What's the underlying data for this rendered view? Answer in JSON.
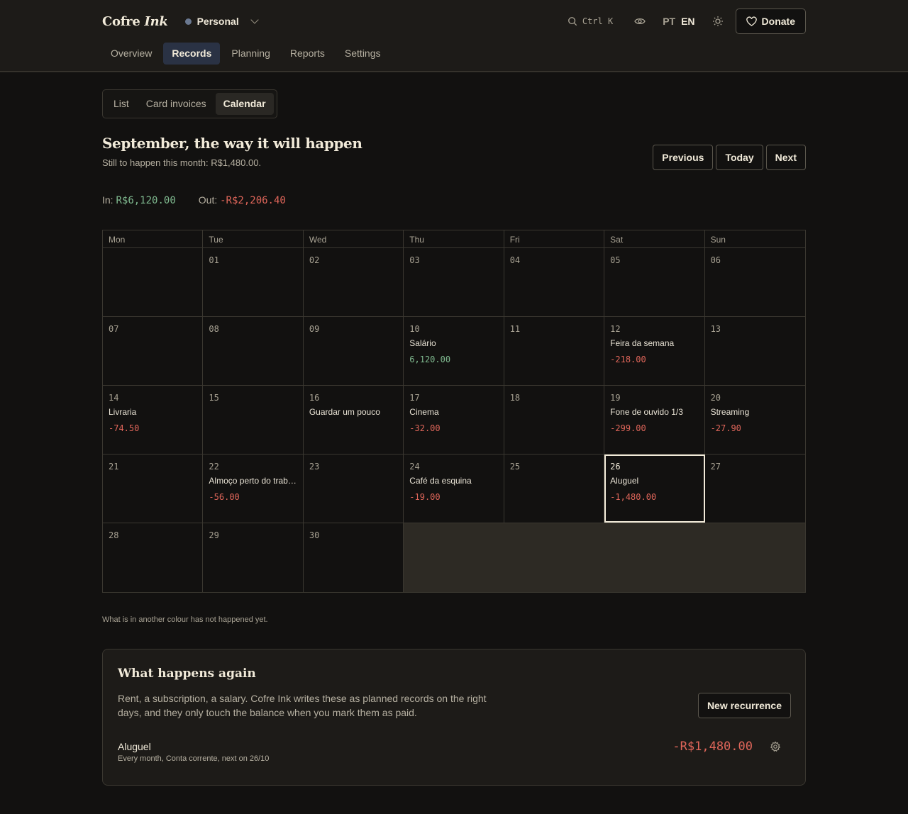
{
  "brand": {
    "name_part1": "Cofre",
    "name_part2": "Ink"
  },
  "ledger": {
    "name": "Personal"
  },
  "search": {
    "shortcut": "Ctrl K"
  },
  "lang": {
    "pt": "PT",
    "en": "EN"
  },
  "donate": {
    "label": "Donate"
  },
  "nav": [
    "Overview",
    "Records",
    "Planning",
    "Reports",
    "Settings"
  ],
  "nav_active": "Records",
  "subtabs": [
    "List",
    "Card invoices",
    "Calendar"
  ],
  "subtab_active": "Calendar",
  "heading": {
    "title": "September, the way it will happen",
    "subtitle": "Still to happen this month: R$1,480.00."
  },
  "pager": {
    "previous": "Previous",
    "today": "Today",
    "next": "Next"
  },
  "totals": {
    "in_label": "In:",
    "in_value": "R$6,120.00",
    "out_label": "Out:",
    "out_value": "-R$2,206.40"
  },
  "calendar": {
    "weekdays": [
      "Mon",
      "Tue",
      "Wed",
      "Thu",
      "Fri",
      "Sat",
      "Sun"
    ],
    "weeks": [
      [
        {
          "day": ""
        },
        {
          "day": "01"
        },
        {
          "day": "02"
        },
        {
          "day": "03"
        },
        {
          "day": "04"
        },
        {
          "day": "05"
        },
        {
          "day": "06"
        }
      ],
      [
        {
          "day": "07"
        },
        {
          "day": "08"
        },
        {
          "day": "09"
        },
        {
          "day": "10",
          "label": "Salário",
          "amount": "6,120.00",
          "kind": "in"
        },
        {
          "day": "11"
        },
        {
          "day": "12",
          "label": "Feira da semana",
          "amount": "-218.00",
          "kind": "out"
        },
        {
          "day": "13"
        }
      ],
      [
        {
          "day": "14",
          "label": "Livraria",
          "amount": "-74.50",
          "kind": "out"
        },
        {
          "day": "15"
        },
        {
          "day": "16",
          "label": "Guardar um pouco"
        },
        {
          "day": "17",
          "label": "Cinema",
          "amount": "-32.00",
          "kind": "out"
        },
        {
          "day": "18"
        },
        {
          "day": "19",
          "label": "Fone de ouvido 1/3",
          "amount": "-299.00",
          "kind": "out"
        },
        {
          "day": "20",
          "label": "Streaming",
          "amount": "-27.90",
          "kind": "out"
        }
      ],
      [
        {
          "day": "21"
        },
        {
          "day": "22",
          "label": "Almoço perto do trabalho",
          "amount": "-56.00",
          "kind": "out"
        },
        {
          "day": "23"
        },
        {
          "day": "24",
          "label": "Café da esquina",
          "amount": "-19.00",
          "kind": "out"
        },
        {
          "day": "25"
        },
        {
          "day": "26",
          "label": "Aluguel",
          "amount": "-1,480.00",
          "kind": "out",
          "planned": true,
          "today": true
        },
        {
          "day": "27"
        }
      ],
      [
        {
          "day": "28"
        },
        {
          "day": "29"
        },
        {
          "day": "30"
        }
      ]
    ]
  },
  "note": "What is in another colour has not happened yet.",
  "recurrences": {
    "title": "What happens again",
    "description": "Rent, a subscription, a salary. Cofre Ink writes these as planned records on the right days, and they only touch the balance when you mark them as paid.",
    "new_label": "New recurrence",
    "items": [
      {
        "name": "Aluguel",
        "meta": "Every month, Conta corrente, next on 26/10",
        "amount": "-R$1,480.00"
      }
    ]
  },
  "colors": {
    "in": "#7fb98f",
    "out": "#e0665a",
    "planned": "#e8a25c",
    "active_nav": "#2a3244"
  }
}
